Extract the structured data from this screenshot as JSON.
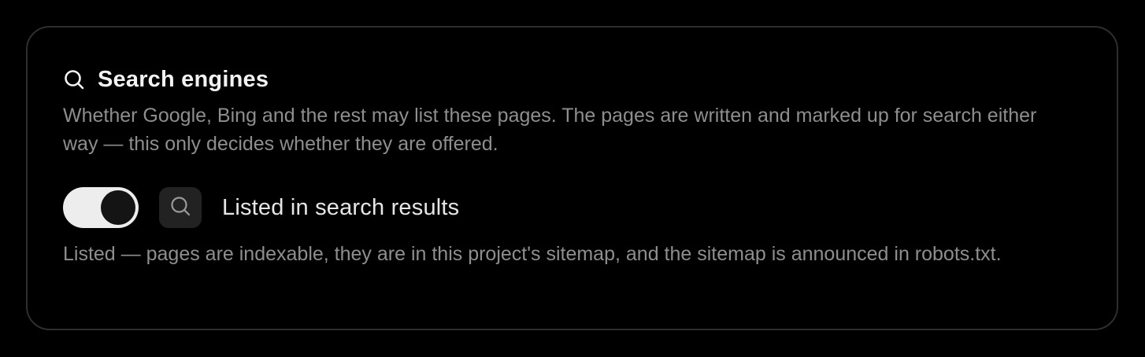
{
  "section": {
    "icon": "search-icon",
    "title": "Search engines",
    "description": "Whether Google, Bing and the rest may list these pages. The pages are written and marked up for search either way — this only decides whether they are offered."
  },
  "indexing": {
    "toggle_on": true,
    "icon": "search-icon",
    "label": "Listed in search results",
    "status_description": "Listed — pages are indexable, they are in this project's sitemap, and the sitemap is announced in robots.txt."
  },
  "colors": {
    "background": "#000000",
    "card_border": "#2e2e2e",
    "toggle_track": "#ededed",
    "toggle_knob": "#141414",
    "muted_text": "#8e8e8e"
  }
}
